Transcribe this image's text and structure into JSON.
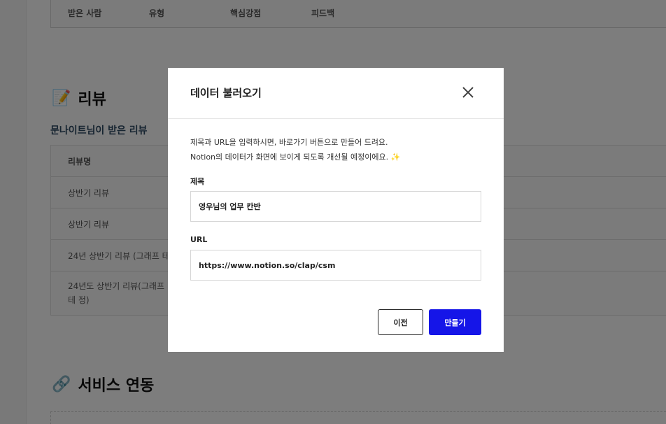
{
  "background": {
    "top_table": {
      "columns": [
        "받은 사람",
        "유형",
        "핵심강점",
        "피드백"
      ]
    },
    "reviews": {
      "emoji": "📝",
      "title": "리뷰",
      "subtitle": "문나이트님이 받은 리뷰",
      "table": {
        "header": "리뷰명",
        "rows": [
          "상반기 리뷰",
          "상반기 리뷰",
          "24년 상반기 리뷰 (그래프 테스",
          "24년도 상반기 리뷰(그래프 테 정)"
        ]
      }
    },
    "services": {
      "emoji": "🔗",
      "title": "서비스 연동"
    }
  },
  "modal": {
    "title": "데이터 불러오기",
    "description_line1": "제목과 URL을 입력하시면, 바로가기 버튼으로 만들어 드려요.",
    "description_line2": "Notion의 데이터가 화면에 보이게 되도록 개선될 예정이에요. ✨",
    "title_label": "제목",
    "title_value": "영우님의 업무 칸반",
    "url_label": "URL",
    "url_value": "https://www.notion.so/clap/csm",
    "prev_button": "이전",
    "create_button": "만들기"
  },
  "colors": {
    "primary_button": "#1515e8",
    "overlay": "rgba(0,0,0,0.5)"
  }
}
